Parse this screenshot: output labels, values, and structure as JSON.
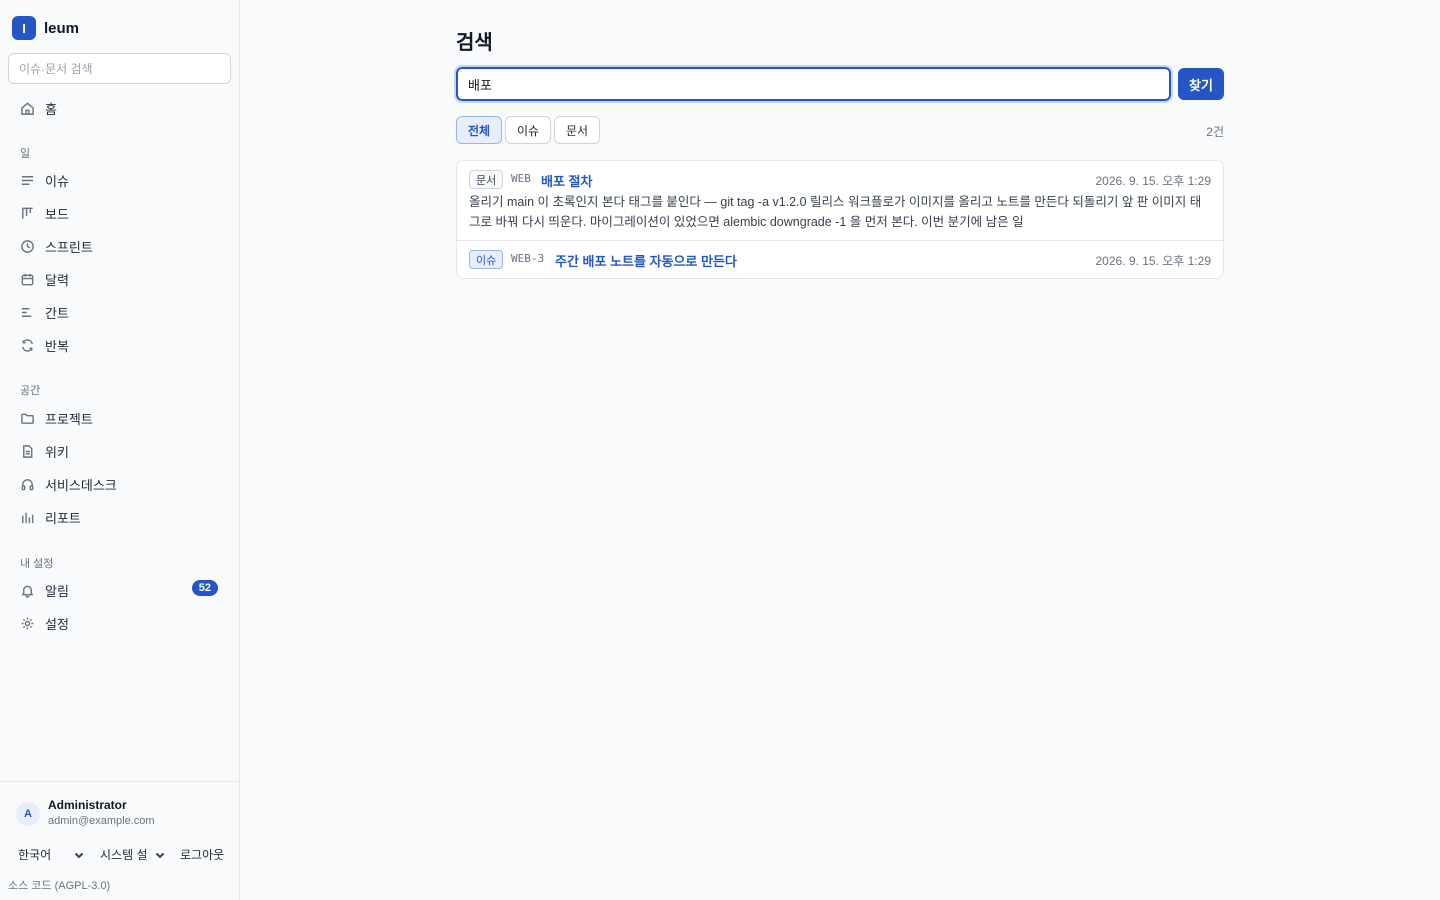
{
  "app": {
    "logo_letter": "I",
    "name": "leum"
  },
  "sidebar": {
    "search_placeholder": "이슈·문서 검색",
    "home": "홈",
    "sections": {
      "work": "일",
      "space": "공간",
      "my_settings": "내 설정"
    },
    "work_items": [
      {
        "label": "이슈",
        "icon": "list-icon"
      },
      {
        "label": "보드",
        "icon": "board-icon"
      },
      {
        "label": "스프린트",
        "icon": "clock-icon"
      },
      {
        "label": "달력",
        "icon": "calendar-icon"
      },
      {
        "label": "간트",
        "icon": "gantt-icon"
      },
      {
        "label": "반복",
        "icon": "repeat-icon"
      }
    ],
    "space_items": [
      {
        "label": "프로젝트",
        "icon": "folder-icon"
      },
      {
        "label": "위키",
        "icon": "document-icon"
      },
      {
        "label": "서비스데스크",
        "icon": "headset-icon"
      },
      {
        "label": "리포트",
        "icon": "bar-chart-icon"
      }
    ],
    "my_items": [
      {
        "label": "알림",
        "icon": "bell-icon",
        "badge": "52"
      },
      {
        "label": "설정",
        "icon": "gear-icon"
      }
    ],
    "user": {
      "initial": "A",
      "name": "Administrator",
      "email": "admin@example.com"
    },
    "footer": {
      "language": "한국어",
      "theme": "시스템 설",
      "logout": "로그아웃",
      "source": "소스 코드 (AGPL-3.0)"
    }
  },
  "main": {
    "title": "검색",
    "search_value": "배포",
    "find_button": "찾기",
    "filters": [
      "전체",
      "이슈",
      "문서"
    ],
    "active_filter": "전체",
    "result_count": "2건",
    "results": [
      {
        "type": "문서",
        "key": "WEB",
        "title": "배포 절차",
        "date": "2026. 9. 15. 오후 1:29",
        "snippet": "올리기 main 이 초록인지 본다 태그를 붙인다 — git tag -a v1.2.0 릴리스 워크플로가 이미지를 올리고 노트를 만든다 되돌리기 앞 판 이미지 태그로 바꿔 다시 띄운다. 마이그레이션이 있었으면 alembic downgrade -1 을 먼저 본다. 이번 분기에 남은 일"
      },
      {
        "type": "이슈",
        "key": "WEB-3",
        "title": "주간 배포 노트를 자동으로 만든다",
        "date": "2026. 9. 15. 오후 1:29"
      }
    ]
  },
  "colors": {
    "accent": "#2457c5",
    "border": "#e5e7eb",
    "background": "#f9fafb"
  }
}
